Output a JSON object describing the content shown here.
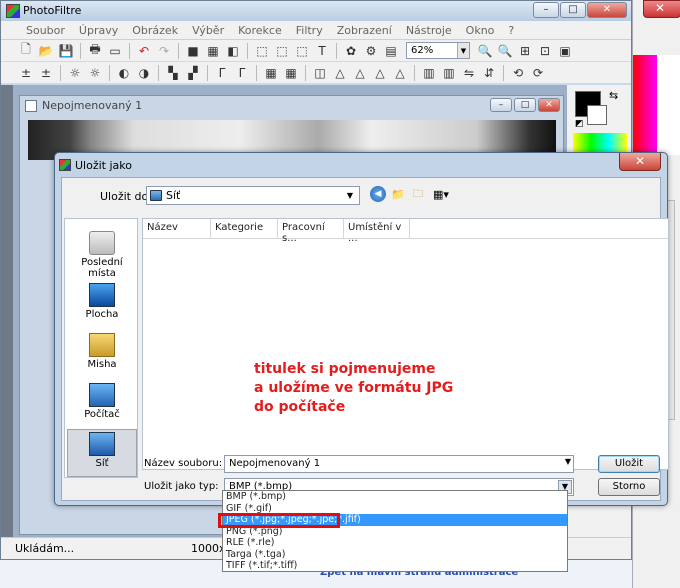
{
  "app": {
    "title": "PhotoFiltre",
    "menu": [
      "Soubor",
      "Úpravy",
      "Obrázek",
      "Výběr",
      "Korekce",
      "Filtry",
      "Zobrazení",
      "Nástroje",
      "Okno",
      "?"
    ],
    "zoom": "62%",
    "window_buttons": {
      "minimize": "–",
      "maximize": "□",
      "close": "✕"
    }
  },
  "document": {
    "title": "Nepojmenovaný 1"
  },
  "status": {
    "left": "Ukládám...",
    "size": "1000x3"
  },
  "dialog": {
    "title": "Uložit jako",
    "save_in_label": "Uložit do:",
    "save_in_value": "Síť",
    "places": [
      {
        "label": "Poslední místa",
        "icon": "recent-places-icon"
      },
      {
        "label": "Plocha",
        "icon": "desktop-icon"
      },
      {
        "label": "Misha",
        "icon": "user-folder-icon"
      },
      {
        "label": "Počítač",
        "icon": "computer-icon"
      },
      {
        "label": "Síť",
        "icon": "network-icon"
      }
    ],
    "columns": [
      "Název",
      "Kategorie",
      "Pracovní s...",
      "Umístění v ..."
    ],
    "annotation": [
      "titulek si pojmenujeme",
      "a uložíme ve formátu JPG",
      "do počítače"
    ],
    "filename_label": "Název souboru:",
    "filename_value": "Nepojmenovaný 1",
    "filetype_label": "Uložit jako typ:",
    "filetype_value": "BMP (*.bmp)",
    "save_button": "Uložit",
    "cancel_button": "Storno",
    "filetype_options": [
      "BMP (*.bmp)",
      "GIF (*.gif)",
      "JPEG (*.jpg;*.jpeg;*.jpe;*.jfif)",
      "PNG (*.png)",
      "RLE (*.rle)",
      "Targa (*.tga)",
      "TIFF (*.tif;*.tiff)"
    ],
    "selected_option_index": 2
  },
  "desktop": {
    "bottom_link": "Zpět na hlavní stranu administrace"
  }
}
